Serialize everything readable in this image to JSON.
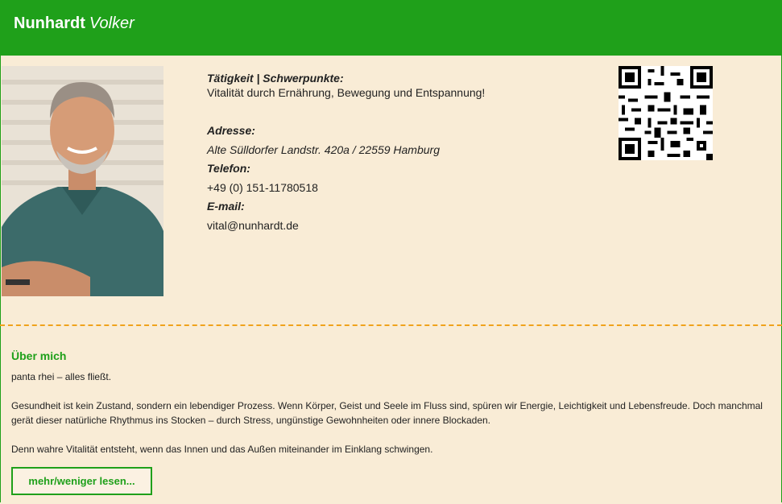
{
  "header": {
    "last_name": "Nunhardt",
    "first_name": "Volker",
    "background_color": "#1fa01a"
  },
  "profile": {
    "activity_label": "Tätigkeit | Schwerpunkte:",
    "activity_value": "Vitalität durch Ernährung, Bewegung und Entspannung!",
    "address_label": "Adresse:",
    "address_value": "Alte Sülldorfer Landstr. 420a / 22559 Hamburg",
    "phone_label": "Telefon:",
    "phone_value": "+49 (0) 151-11780518",
    "email_label": "E-mail:",
    "email_value": "vital@nunhardt.de"
  },
  "about": {
    "title": "Über mich",
    "paragraph1": "panta rhei – alles fließt.",
    "paragraph2": "Gesundheit ist kein Zustand, sondern ein lebendiger Prozess. Wenn Körper, Geist und Seele im Fluss sind, spüren wir Energie, Leichtigkeit und Lebensfreude. Doch manchmal gerät dieser natürliche Rhythmus ins Stocken – durch Stress, ungünstige Gewohnheiten oder innere Blockaden.",
    "paragraph3": "Denn wahre Vitalität entsteht, wenn das Innen und das Außen miteinander im Einklang schwingen.",
    "more_button": "mehr/weniger lesen..."
  },
  "colors": {
    "accent": "#1fa01a",
    "background": "#f9ecd6",
    "divider": "#f0a21c"
  },
  "icons": {
    "qr": "qr-code-icon",
    "photo": "profile-photo"
  }
}
